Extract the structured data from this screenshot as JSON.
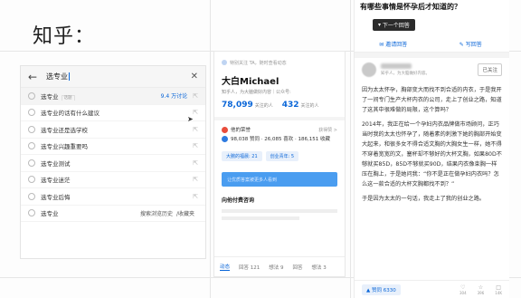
{
  "slide": {
    "title": "知乎："
  },
  "search": {
    "query": "选专业",
    "suggestions": [
      {
        "label": "选专业",
        "badge": "话题",
        "meta": "9.4 万讨论"
      },
      {
        "label": "选专业的话有什么建议"
      },
      {
        "label": "选专业还是选学校"
      },
      {
        "label": "选专业兴趣重要吗"
      },
      {
        "label": "选专业测试"
      },
      {
        "label": "选专业迷茫"
      },
      {
        "label": "选专业后悔"
      },
      {
        "label": "选专业",
        "links": [
          "搜索浏览历史",
          "/收藏夹"
        ]
      }
    ]
  },
  "profile": {
    "top_note": "特别关注 TA，随时查看动态",
    "name": "大白Michael",
    "subtitle": "知乎人，为大脑做好内容｜公众号:",
    "stats": [
      {
        "num": "78,099",
        "label": "关注的人"
      },
      {
        "num": "432",
        "label": "关注的人"
      }
    ],
    "achievements_title": "他的荣誉",
    "achievements_more": "获得赞 >",
    "achievements_line": "98,038 赞同 · 26,085 喜欢 · 186,151 收藏",
    "tags": [
      "大腕的福晨: 21",
      "创业青年: 5"
    ],
    "banner_text": "让优质答案被更多人看到",
    "section_title": "向他付费咨询",
    "tabs": [
      "动态",
      "回答 121",
      "想法 9",
      "回答",
      "想法 3"
    ]
  },
  "answer": {
    "question": "有哪些事情是怀孕后才知道的？",
    "next_button": "下一个回答",
    "actions": [
      "邀请回答",
      "写回答"
    ],
    "author_desc": "知乎人，为大脑做好内容。",
    "follow": "已关注",
    "paragraphs": [
      "因为太太怀孕，胸部变大而找不到合适的内衣，于是我开了一间专门生产大杯内衣的公司，走上了创业之路，知道了这其中很难做的局限，这个算吗？",
      "2014年，我正在给一个孕妇内衣品牌做市场顾问，正巧当时我的太太也怀孕了，随着素的刺激下她的胸部开始变大起来，和很多女不得合适文胸的大胸女生一样，她不得不穿着宽宽的文，塞杯却不够好的大杯文胸，如果80D不够就买85D，85D不够就买90D，结果内衣像束胸一样压在胸上，于是她问我：“你不是正在做孕妇内衣吗？怎么这一款合适的大杯文胸都找不到？”",
      "于是因为太太的一句话，我走上了我的创业之路。"
    ],
    "upvote": "赞同 6330",
    "icon_counts": [
      "304",
      "396",
      "14K"
    ]
  }
}
